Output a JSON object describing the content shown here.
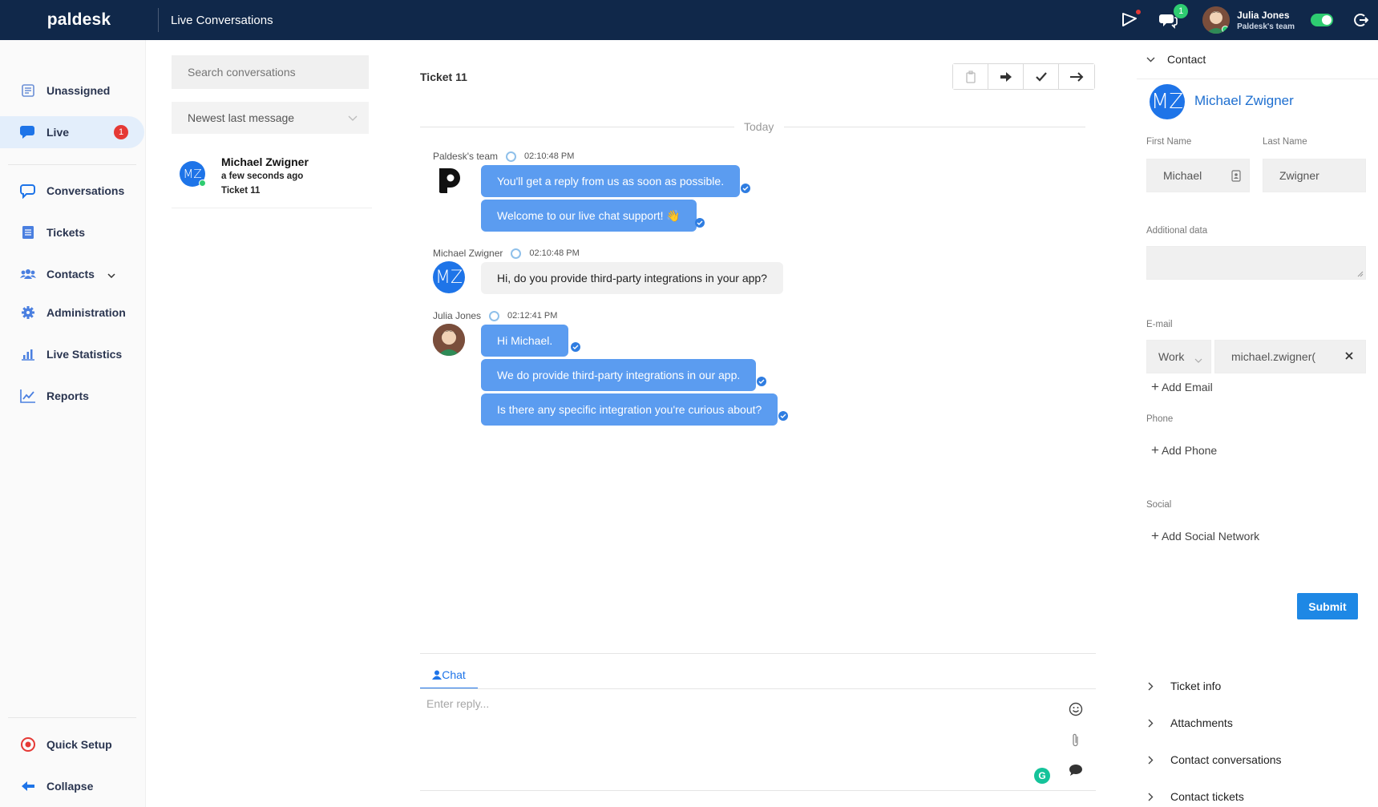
{
  "app": {
    "logo": "paldesk",
    "title": "Live Conversations"
  },
  "topbar": {
    "chat_badge": "1",
    "user_name": "Julia Jones",
    "user_team": "Paldesk's team"
  },
  "nav": {
    "unassigned": "Unassigned",
    "live": "Live",
    "live_badge": "1",
    "conversations": "Conversations",
    "tickets": "Tickets",
    "contacts": "Contacts",
    "administration": "Administration",
    "live_statistics": "Live Statistics",
    "reports": "Reports",
    "quick_setup": "Quick Setup",
    "collapse": "Collapse"
  },
  "list": {
    "search_placeholder": "Search conversations",
    "sort": "Newest last message",
    "items": [
      {
        "initials": "MZ",
        "name": "Michael Zwigner",
        "time": "a few seconds ago",
        "ticket": "Ticket 11"
      }
    ]
  },
  "chat": {
    "title": "Ticket 11",
    "date_divider": "Today",
    "groups": [
      {
        "sender": "Paldesk's team",
        "time": "02:10:48 PM",
        "messages": [
          "You'll get a reply from us as soon as possible.",
          "Welcome to our live chat support! 👋"
        ]
      },
      {
        "sender": "Michael Zwigner",
        "initials": "MZ",
        "time": "02:10:48 PM",
        "messages": [
          "Hi, do you provide third-party integrations in your app?"
        ]
      },
      {
        "sender": "Julia Jones",
        "time": "02:12:41 PM",
        "messages": [
          "Hi Michael.",
          "We do provide third-party integrations in our app.",
          "Is there any specific integration you're curious about?"
        ]
      }
    ],
    "tab_label": "Chat",
    "reply_placeholder": "Enter reply...",
    "grammarly": "G"
  },
  "contact": {
    "section_title": "Contact",
    "initials": "MZ",
    "full_name": "Michael Zwigner",
    "first_name_label": "First Name",
    "first_name": "Michael",
    "last_name_label": "Last Name",
    "last_name": "Zwigner",
    "additional_label": "Additional data",
    "email_label": "E-mail",
    "email_type": "Work",
    "email_value": "michael.zwigner(",
    "add_email": "Add Email",
    "phone_label": "Phone",
    "add_phone": "Add Phone",
    "social_label": "Social",
    "add_social": "Add Social Network",
    "submit": "Submit"
  },
  "accordion": [
    "Ticket info",
    "Attachments",
    "Contact conversations",
    "Contact tickets"
  ],
  "colors": {
    "topbar": "#10284a",
    "accent": "#1e74e8",
    "bubble_out": "#5b9cf0",
    "badge_red": "#e53935",
    "online": "#2ecc71"
  }
}
